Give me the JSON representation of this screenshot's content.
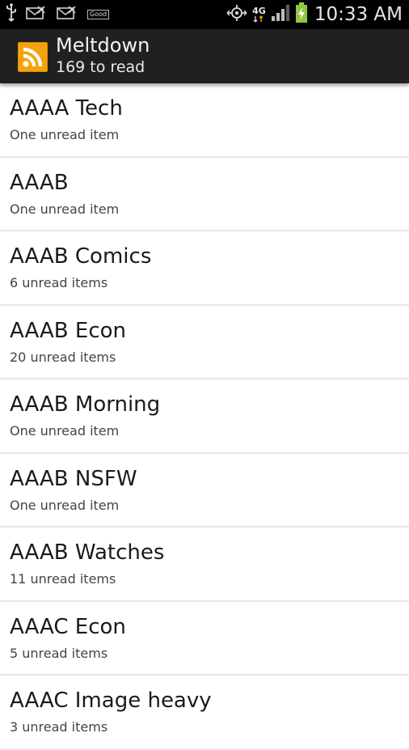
{
  "status_bar": {
    "time": "10:33 AM",
    "network": "4G",
    "notification_badge": "Good",
    "icons": [
      "usb-icon",
      "missed-mail-icon",
      "missed-mail-icon",
      "good-badge-icon",
      "location-icon",
      "4g-lte-icon",
      "signal-icon",
      "battery-charging-icon"
    ]
  },
  "action_bar": {
    "title": "Meltdown",
    "subtitle": "169 to read",
    "icon": "rss-icon",
    "accent_color": "#f5a30d"
  },
  "feeds": [
    {
      "name": "AAAA Tech",
      "unread": "One unread item"
    },
    {
      "name": "AAAB",
      "unread": "One unread item"
    },
    {
      "name": "AAAB Comics",
      "unread": "6 unread items"
    },
    {
      "name": "AAAB Econ",
      "unread": "20 unread items"
    },
    {
      "name": "AAAB Morning",
      "unread": "One unread item"
    },
    {
      "name": "AAAB NSFW",
      "unread": "One unread item"
    },
    {
      "name": "AAAB Watches",
      "unread": "11 unread items"
    },
    {
      "name": "AAAC Econ",
      "unread": "5 unread items"
    },
    {
      "name": "AAAC Image heavy",
      "unread": "3 unread items"
    }
  ]
}
